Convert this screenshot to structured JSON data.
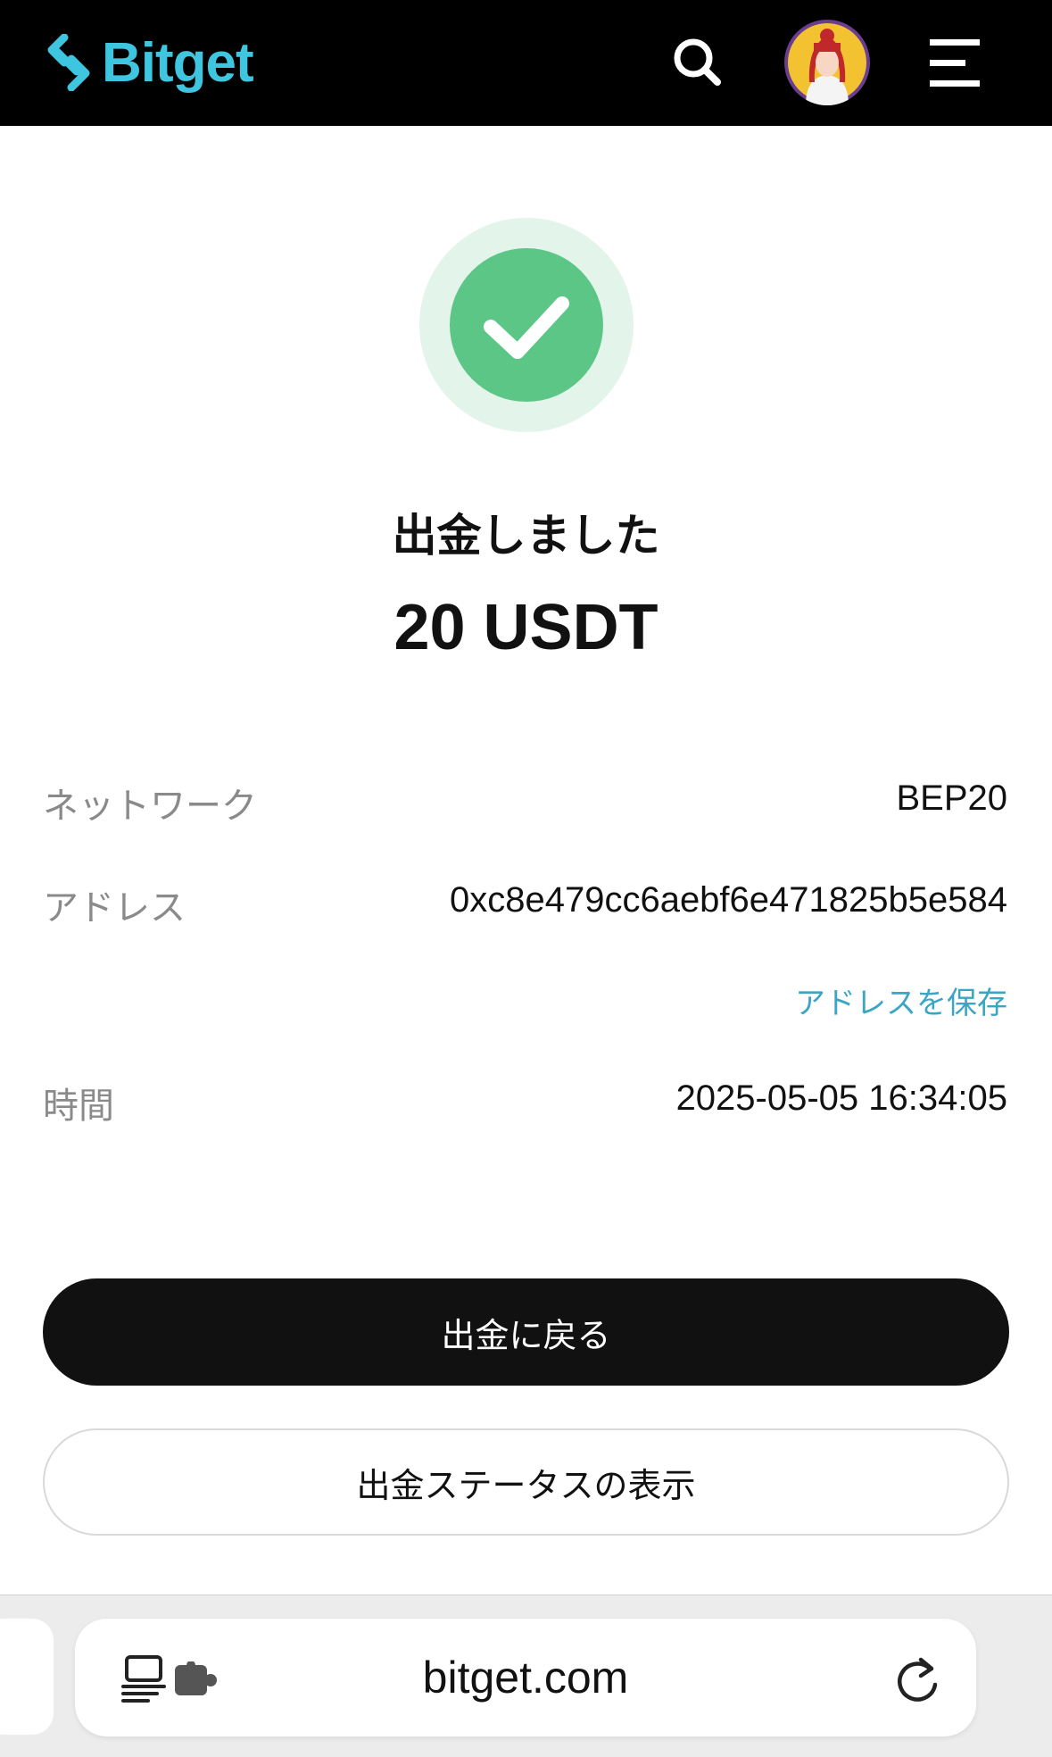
{
  "header": {
    "brand": "Bitget",
    "brand_color": "#3ec6e0",
    "icons": [
      "search-icon",
      "avatar",
      "menu-icon"
    ]
  },
  "result": {
    "status_icon": "check-circle-icon",
    "status_color": "#5bc685",
    "title": "出金しました",
    "amount": "20 USDT"
  },
  "details": {
    "network_label": "ネットワーク",
    "network_value": "BEP20",
    "address_label": "アドレス",
    "address_value": "0xc8e479cc6aebf6e471825b5e584",
    "save_address": "アドレスを保存",
    "time_label": "時間",
    "time_value": "2025-05-05 16:34:05"
  },
  "actions": {
    "back_label": "出金に戻る",
    "status_label": "出金ステータスの表示"
  },
  "browser": {
    "url": "bitget.com",
    "icons": [
      "reader-icon",
      "extension-icon",
      "reload-icon"
    ]
  }
}
